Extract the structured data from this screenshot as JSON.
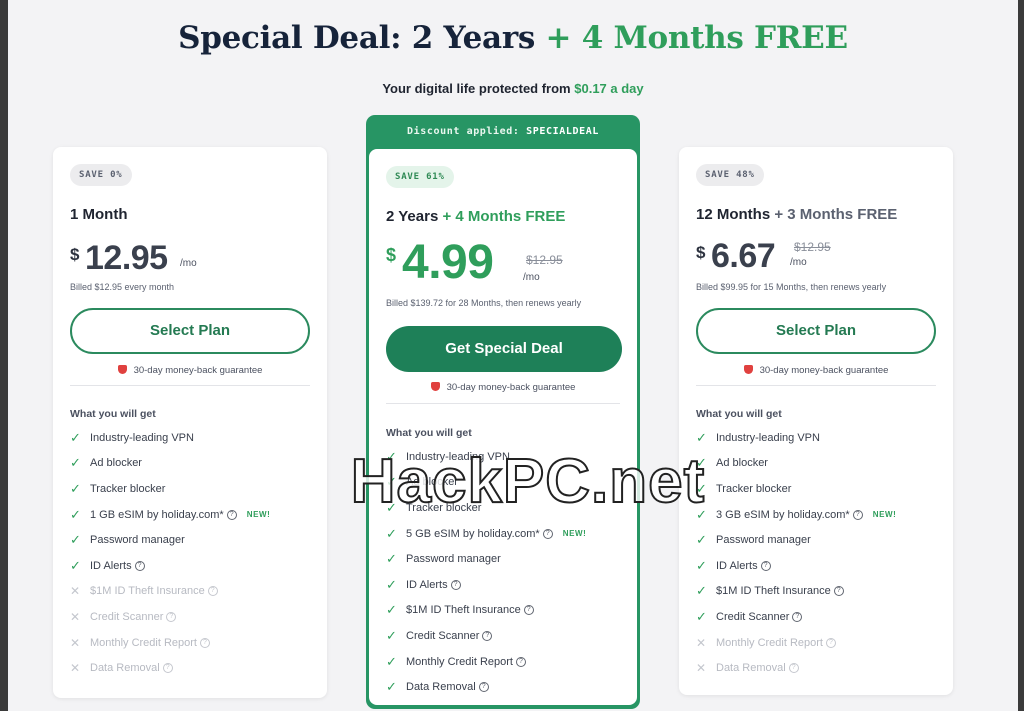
{
  "header": {
    "title_main": "Special Deal: 2 Years",
    "title_accent": "+ 4 Months FREE",
    "subtitle_prefix": "Your digital life protected from",
    "subtitle_price": "$0.17 a day"
  },
  "plans": {
    "monthly": {
      "badge": "SAVE 0%",
      "name": "1 Month",
      "currency": "$",
      "price": "12.95",
      "per": "/mo",
      "billed": "Billed $12.95 every month",
      "button": "Select Plan",
      "guarantee": "30-day money-back guarantee",
      "features_heading": "What you will get",
      "features": [
        {
          "label": "Industry-leading VPN",
          "included": true
        },
        {
          "label": "Ad blocker",
          "included": true
        },
        {
          "label": "Tracker blocker",
          "included": true
        },
        {
          "label": "1 GB eSIM by holiday.com*",
          "included": true,
          "info": true,
          "new": "NEW!"
        },
        {
          "label": "Password manager",
          "included": true
        },
        {
          "label": "ID Alerts",
          "included": true,
          "info": true
        },
        {
          "label": "$1M ID Theft Insurance",
          "included": false,
          "info": true
        },
        {
          "label": "Credit Scanner",
          "included": false,
          "info": true
        },
        {
          "label": "Monthly Credit Report",
          "included": false,
          "info": true
        },
        {
          "label": "Data Removal",
          "included": false,
          "info": true
        }
      ]
    },
    "special": {
      "banner_prefix": "Discount applied:",
      "banner_code": "SPECIALDEAL",
      "badge": "SAVE 61%",
      "name_main": "2 Years",
      "name_accent": "+ 4 Months FREE",
      "currency": "$",
      "price": "4.99",
      "old_price": "$12.95",
      "per": "/mo",
      "billed": "Billed $139.72 for 28 Months, then renews yearly",
      "button": "Get Special Deal",
      "guarantee": "30-day money-back guarantee",
      "features_heading": "What you will get",
      "features": [
        {
          "label": "Industry-leading VPN",
          "included": true
        },
        {
          "label": "Ad blocker",
          "included": true
        },
        {
          "label": "Tracker blocker",
          "included": true
        },
        {
          "label": "5 GB eSIM by holiday.com*",
          "included": true,
          "info": true,
          "new": "NEW!"
        },
        {
          "label": "Password manager",
          "included": true
        },
        {
          "label": "ID Alerts",
          "included": true,
          "info": true
        },
        {
          "label": "$1M ID Theft Insurance",
          "included": true,
          "info": true
        },
        {
          "label": "Credit Scanner",
          "included": true,
          "info": true
        },
        {
          "label": "Monthly Credit Report",
          "included": true,
          "info": true
        },
        {
          "label": "Data Removal",
          "included": true,
          "info": true
        }
      ]
    },
    "yearly": {
      "badge": "SAVE 48%",
      "name_main": "12 Months",
      "name_accent": "+ 3 Months FREE",
      "currency": "$",
      "price": "6.67",
      "old_price": "$12.95",
      "per": "/mo",
      "billed": "Billed $99.95 for 15 Months, then renews yearly",
      "button": "Select Plan",
      "guarantee": "30-day money-back guarantee",
      "features_heading": "What you will get",
      "features": [
        {
          "label": "Industry-leading VPN",
          "included": true
        },
        {
          "label": "Ad blocker",
          "included": true
        },
        {
          "label": "Tracker blocker",
          "included": true
        },
        {
          "label": "3 GB eSIM by holiday.com*",
          "included": true,
          "info": true,
          "new": "NEW!"
        },
        {
          "label": "Password manager",
          "included": true
        },
        {
          "label": "ID Alerts",
          "included": true,
          "info": true
        },
        {
          "label": "$1M ID Theft Insurance",
          "included": true,
          "info": true
        },
        {
          "label": "Credit Scanner",
          "included": true,
          "info": true
        },
        {
          "label": "Monthly Credit Report",
          "included": false,
          "info": true
        },
        {
          "label": "Data Removal",
          "included": false,
          "info": true
        }
      ]
    }
  },
  "watermark": "HackPC.net",
  "colors": {
    "accent_green": "#2f9e5b",
    "button_green": "#1e8058",
    "headline_navy": "#16233a",
    "shield_red": "#e0413f"
  },
  "icons": {
    "included": "check-icon",
    "excluded": "x-icon",
    "info": "question-circle-icon",
    "guarantee": "shield-icon"
  }
}
